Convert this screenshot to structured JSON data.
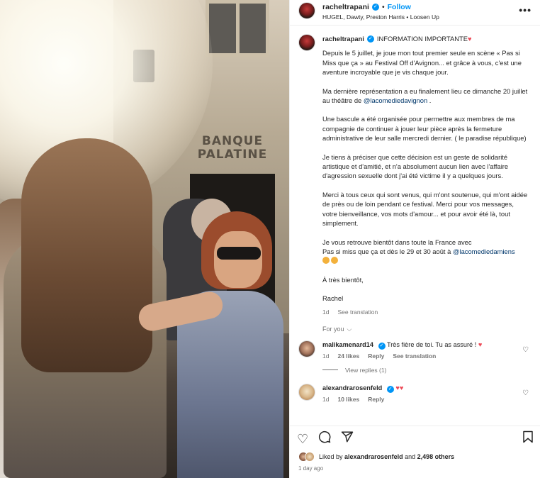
{
  "photo": {
    "bank_sign": "BANQUE PALATINE"
  },
  "header": {
    "username": "racheltrapani",
    "follow_label": "Follow",
    "audio": "HUGEL, Dawty, Preston Harris • Loosen Up",
    "more_label": "•••"
  },
  "caption": {
    "username": "racheltrapani",
    "title": "INFORMATION IMPORTANTE",
    "p1": "Depuis le 5 juillet, je joue mon tout premier seule en scène « Pas si Miss que ça » au Festival Off d'Avignon... et grâce à vous, c'est une aventure incroyable que je vis chaque jour.",
    "p2_text": "Ma dernière représentation a eu finalement lieu ce dimanche 20 juillet au théâtre de",
    "p2_mention": "@lacomediedavignon",
    "p2_end": ".",
    "p3": "Une bascule a été organisée pour permettre aux membres de ma compagnie de continuer à jouer leur pièce après la fermeture administrative de leur salle mercredi dernier. ( le paradise république)",
    "p4": "Je tiens à préciser que cette décision est un geste de solidarité artistique et d'amitié, et n'a absolument aucun lien avec l'affaire d'agression sexuelle dont j'ai été victime il y a quelques jours.",
    "p5": "Merci à tous ceux qui sont venus, qui m'ont soutenue, qui m'ont aidée de près ou de loin pendant ce festival. Merci pour vos messages, votre bienveillance, vos mots d'amour... et pour avoir été là, tout simplement.",
    "p6_line1": "Je vous retrouve bientôt dans toute la France avec",
    "p6_line2": "Pas si miss que ça et dès le 29 et 30 août à",
    "p6_mention": "@lacomediedamiens",
    "p7": "À très bientôt,",
    "p8": "Rachel",
    "time": "1d",
    "see_translation": "See translation"
  },
  "for_you": {
    "label": "For you",
    "chevron": "⌵"
  },
  "comments": [
    {
      "username": "malikamenard14",
      "text": "Très fière de toi. Tu as assuré !",
      "time": "1d",
      "likes": "24 likes",
      "reply": "Reply",
      "see_translation": "See translation",
      "view_replies": "View replies (1)"
    },
    {
      "username": "alexandrarosenfeld",
      "text": "",
      "time": "1d",
      "likes": "10 likes",
      "reply": "Reply"
    }
  ],
  "footer": {
    "liked_by_prefix": "Liked by",
    "liked_by_user": "alexandrarosenfeld",
    "liked_by_and": "and",
    "liked_by_count": "2,498 others",
    "ago": "1 day ago"
  },
  "icons": {
    "like": "heart-outline-icon",
    "comment": "comment-bubble-icon",
    "share": "paper-plane-icon",
    "save": "bookmark-icon"
  },
  "colors": {
    "accent": "#0095f6",
    "mention": "#00376b",
    "heart": "#ed4956",
    "muted": "#737373"
  }
}
